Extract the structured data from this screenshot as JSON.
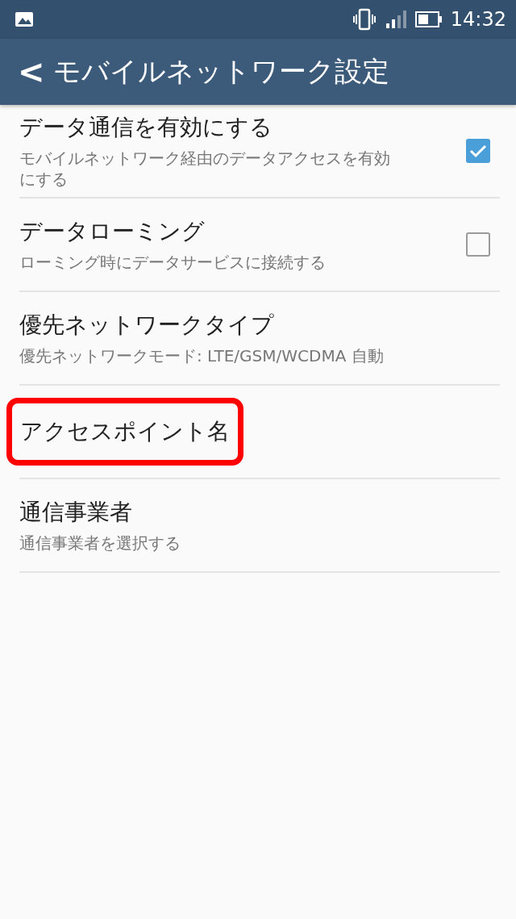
{
  "status_bar": {
    "time": "14:32"
  },
  "header": {
    "back": "<",
    "title": "モバイルネットワーク設定"
  },
  "settings": [
    {
      "kind": "checkbox",
      "title": "データ通信を有効にする",
      "subtitle": "モバイルネットワーク経由のデータアクセスを有効にする",
      "checked": true,
      "highlighted": false
    },
    {
      "kind": "checkbox",
      "title": "データローミング",
      "subtitle": "ローミング時にデータサービスに接続する",
      "checked": false,
      "highlighted": false
    },
    {
      "kind": "plain",
      "title": "優先ネットワークタイプ",
      "subtitle": "優先ネットワークモード: LTE/GSM/WCDMA 自動",
      "highlighted": false
    },
    {
      "kind": "plain",
      "title": "アクセスポイント名",
      "highlighted": true
    },
    {
      "kind": "plain",
      "title": "通信事業者",
      "subtitle": "通信事業者を選択する",
      "highlighted": false
    }
  ]
}
